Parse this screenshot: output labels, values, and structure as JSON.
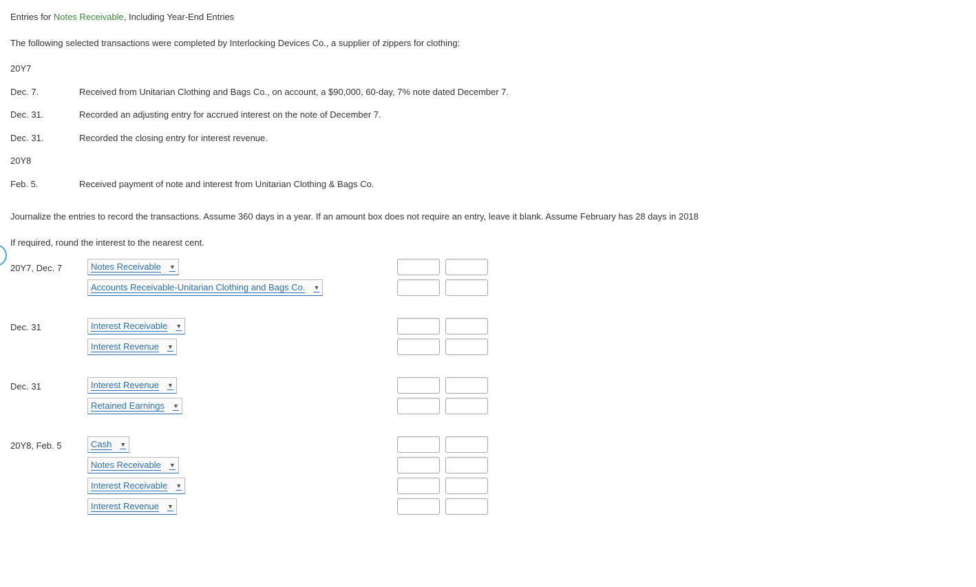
{
  "title_prefix": "Entries for ",
  "title_link": "Notes Receivable",
  "title_suffix": ", Including Year-End Entries",
  "intro": "The following selected transactions were completed by Interlocking Devices Co., a supplier of zippers for clothing:",
  "year1": "20Y7",
  "year2": "20Y8",
  "transactions": [
    {
      "date": "Dec. 7.",
      "desc": "Received from Unitarian Clothing and Bags Co., on account, a $90,000, 60-day, 7% note dated December 7."
    },
    {
      "date": "Dec. 31.",
      "desc": "Recorded an adjusting entry for accrued interest on the note of December 7."
    },
    {
      "date": "Dec. 31.",
      "desc": "Recorded the closing entry for interest revenue."
    }
  ],
  "transactions2": [
    {
      "date": "Feb. 5.",
      "desc": "Received payment of note and interest from Unitarian Clothing & Bags Co."
    }
  ],
  "instructions": "Journalize the entries to record the transactions. Assume 360 days in a year. If an amount box does not require an entry, leave it blank. Assume February has 28 days in 2018",
  "round_note": "If required, round the interest to the nearest cent.",
  "journal": [
    {
      "date_label": "20Y7, Dec. 7",
      "rows": [
        {
          "account": "Notes Receivable"
        },
        {
          "account": "Accounts Receivable-Unitarian Clothing and Bags Co."
        }
      ]
    },
    {
      "date_label": "Dec. 31",
      "rows": [
        {
          "account": "Interest Receivable"
        },
        {
          "account": "Interest Revenue"
        }
      ]
    },
    {
      "date_label": "Dec. 31",
      "rows": [
        {
          "account": "Interest Revenue"
        },
        {
          "account": "Retained Earnings"
        }
      ]
    },
    {
      "date_label": "20Y8, Feb. 5",
      "rows": [
        {
          "account": "Cash"
        },
        {
          "account": "Notes Receivable"
        },
        {
          "account": "Interest Receivable"
        },
        {
          "account": "Interest Revenue"
        }
      ]
    }
  ]
}
